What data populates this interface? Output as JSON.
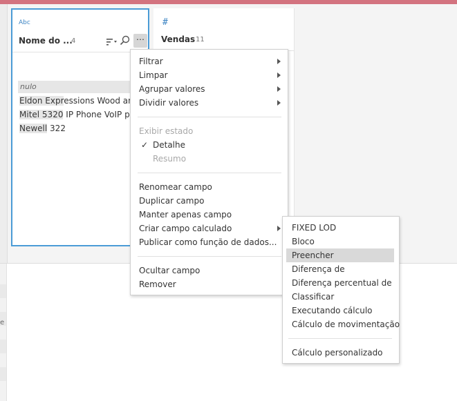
{
  "card1": {
    "type_label": "Abc",
    "field_name": "Nome do ...",
    "count": "4",
    "more_glyph": "⋯",
    "values": [
      {
        "text": "nulo"
      },
      {
        "hl": "Eldon Expr",
        "rest": "essions Wood and"
      },
      {
        "hl": "Mitel 5320",
        "rest": " IP Phone VoIP pho"
      },
      {
        "hl": "Newell",
        "rest": " 322"
      }
    ]
  },
  "card2": {
    "type_label": "#",
    "field_name": "Vendas",
    "count": "11"
  },
  "context_menu": {
    "items": {
      "filter": "Filtrar",
      "clean": "Limpar",
      "group_values": "Agrupar valores",
      "split_values": "Dividir valores",
      "view_state_header": "Exibir estado",
      "check_glyph": "✓",
      "detail": "Detalhe",
      "summary": "Resumo",
      "rename_field": "Renomear campo",
      "duplicate_field": "Duplicar campo",
      "keep_only_field": "Manter apenas campo",
      "create_calculated_field": "Criar campo calculado",
      "publish_as_data_role": "Publicar como função de dados...",
      "hide_field": "Ocultar campo",
      "remove": "Remover"
    }
  },
  "submenu": {
    "items": {
      "fixed_lod": "FIXED LOD",
      "tile": "Bloco",
      "fill": "Preencher",
      "difference": "Diferença de",
      "percent_difference": "Diferença percentual de",
      "rank": "Classificar",
      "running_calc": "Executando cálculo",
      "moving_calc": "Cálculo de movimentação",
      "custom_calc": "Cálculo personalizado"
    }
  },
  "left_gutter_mark": "e",
  "colors": {
    "top_bar": "#d3737f",
    "selected_card_border": "#4a9bd6",
    "type_icon": "#3f86c4",
    "menu_highlight": "#d9d9d9"
  }
}
